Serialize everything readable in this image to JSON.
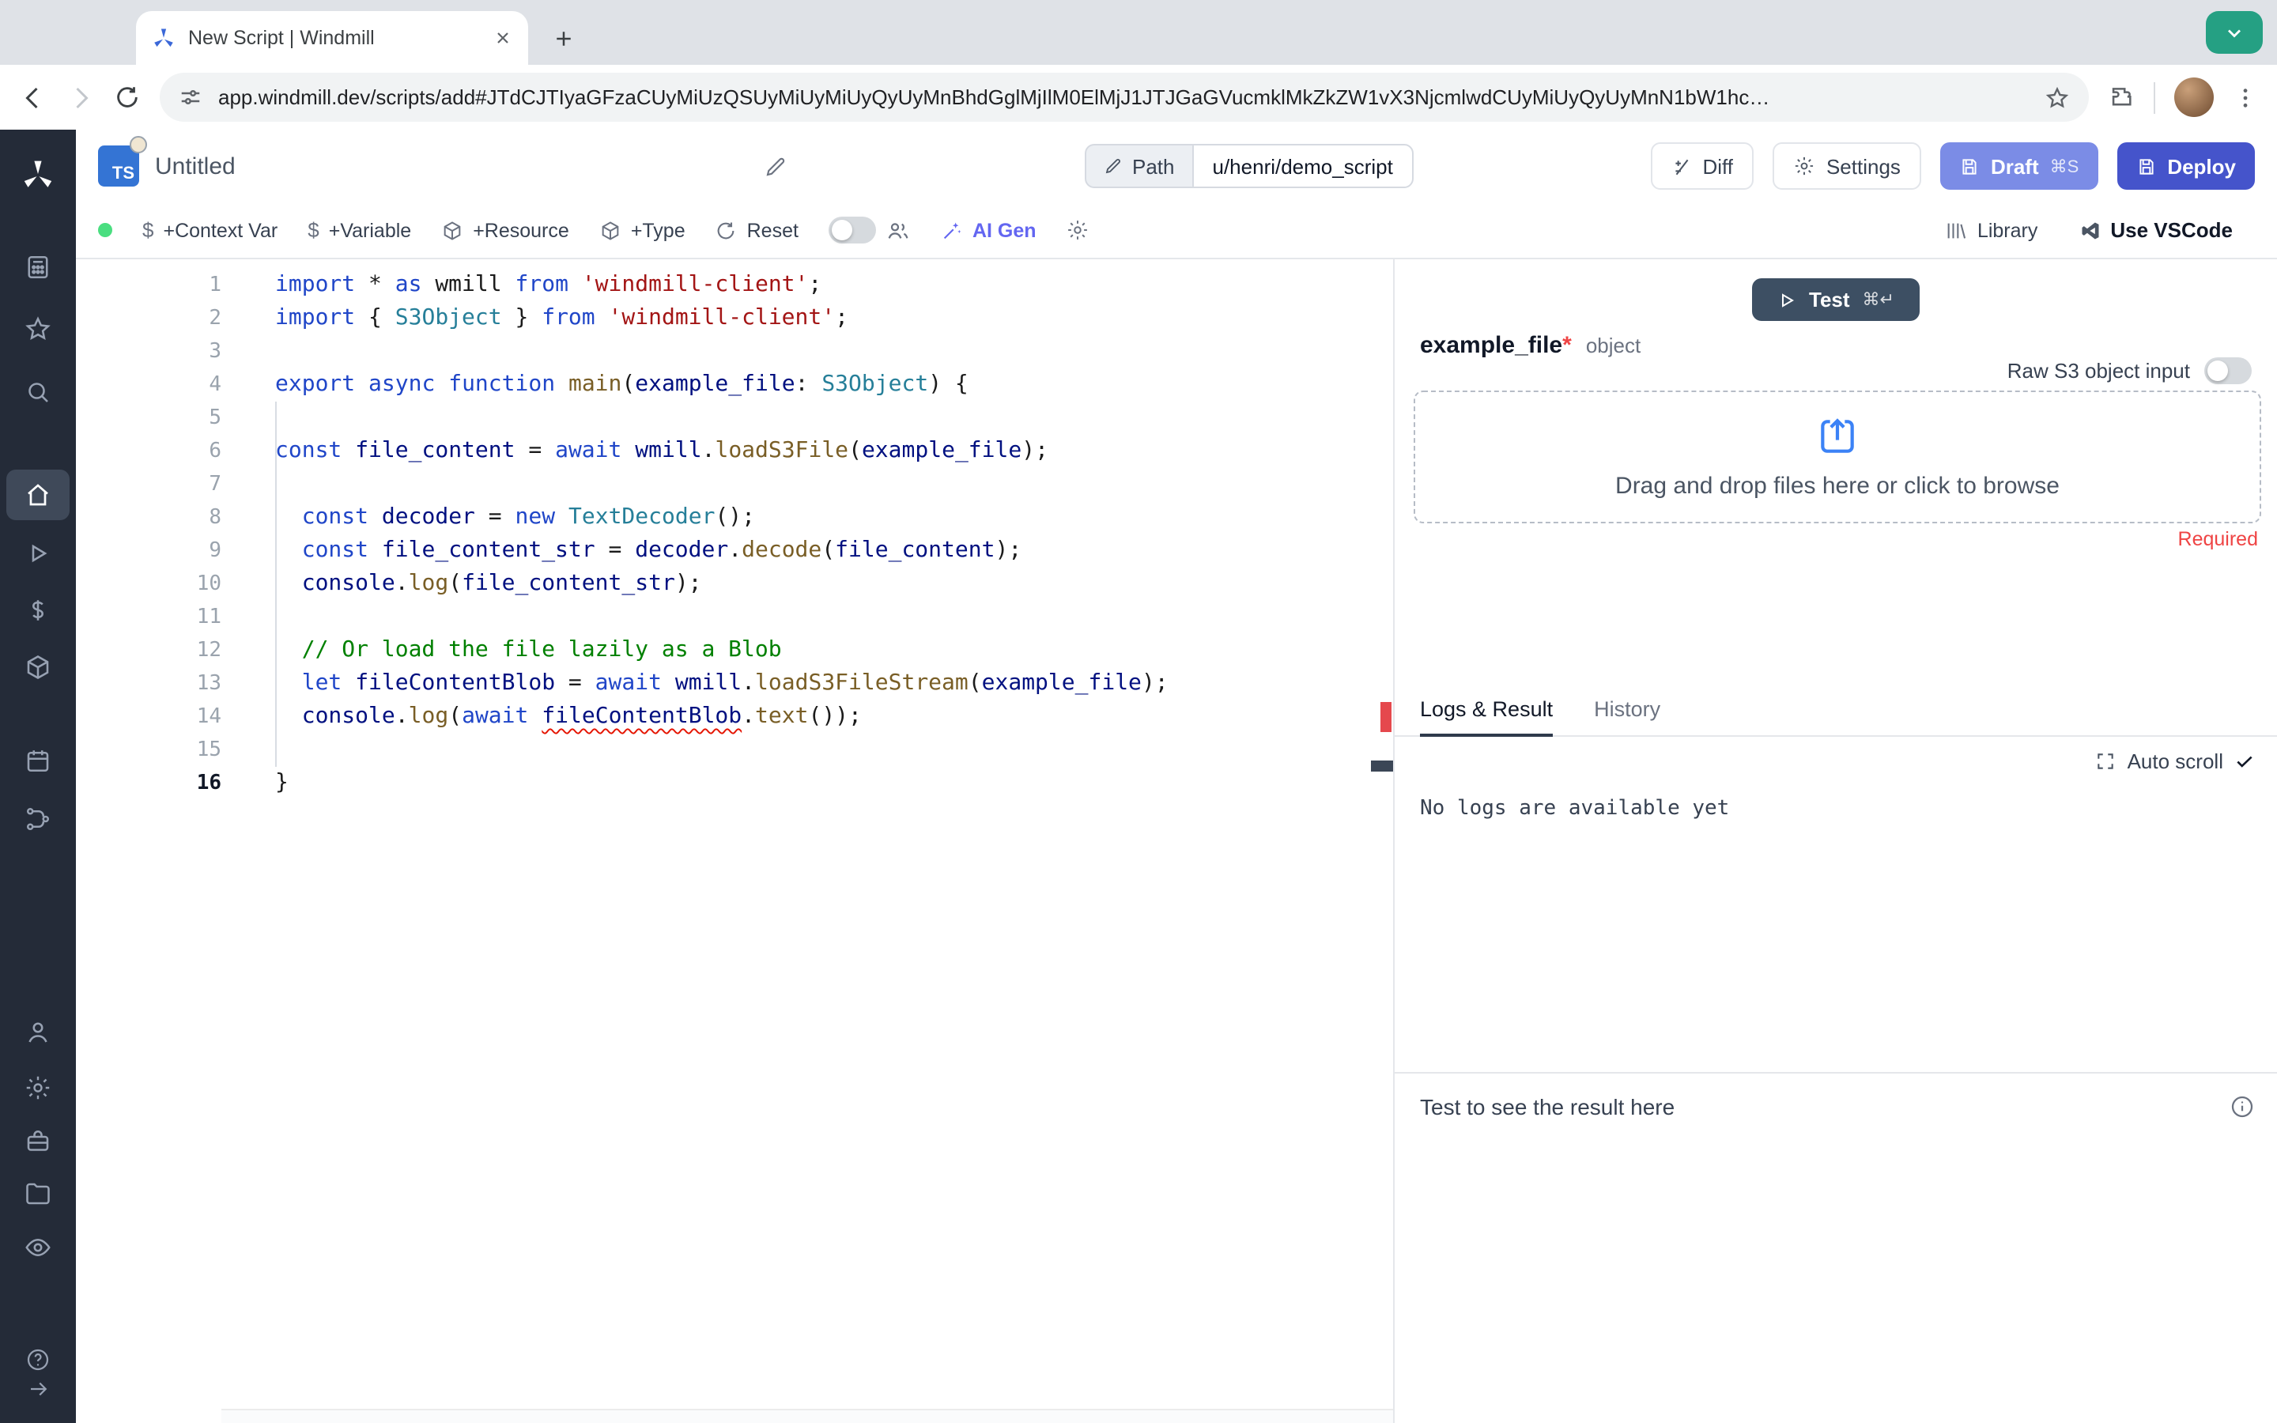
{
  "browser": {
    "tab_title": "New Script | Windmill",
    "url": "app.windmill.dev/scripts/add#JTdCJTIyaGFzaCUyMiUzQSUyMiUyMiUyQyUyMnBhdGglMjIlM0ElMjJ1JTJGaGVucmklMkZkZW1vX3NjcmlwdCUyMiUyQyUyMnN1bW1hc…"
  },
  "header": {
    "ts_badge": "TS",
    "title": "Untitled",
    "path_label": "Path",
    "path_value": "u/henri/demo_script",
    "diff_label": "Diff",
    "settings_label": "Settings",
    "draft_label": "Draft",
    "draft_shortcut": "⌘S",
    "deploy_label": "Deploy"
  },
  "toolbar": {
    "context_var": "+Context Var",
    "variable": "+Variable",
    "resource": "+Resource",
    "type": "+Type",
    "reset": "Reset",
    "ai_gen": "AI Gen",
    "library": "Library",
    "vscode": "Use VSCode"
  },
  "sidebar": {
    "item_names": [
      "windmill-logo",
      "apps",
      "favorites",
      "search",
      "home",
      "runs",
      "variables",
      "resources",
      "schedules",
      "flows",
      "user",
      "settings",
      "workers",
      "folders",
      "audit-logs",
      "help",
      "collapse"
    ]
  },
  "editor": {
    "lines": [
      {
        "n": 1,
        "tokens": [
          [
            "k",
            "import"
          ],
          [
            "p",
            " * "
          ],
          [
            "k",
            "as"
          ],
          [
            "p",
            " wmill "
          ],
          [
            "k",
            "from"
          ],
          [
            "p",
            " "
          ],
          [
            "s",
            "'windmill-client'"
          ],
          [
            "p",
            ";"
          ]
        ]
      },
      {
        "n": 2,
        "tokens": [
          [
            "k",
            "import"
          ],
          [
            "p",
            " { "
          ],
          [
            "t",
            "S3Object"
          ],
          [
            "p",
            " } "
          ],
          [
            "k",
            "from"
          ],
          [
            "p",
            " "
          ],
          [
            "s",
            "'windmill-client'"
          ],
          [
            "p",
            ";"
          ]
        ]
      },
      {
        "n": 3,
        "tokens": []
      },
      {
        "n": 4,
        "tokens": [
          [
            "k",
            "export"
          ],
          [
            "p",
            " "
          ],
          [
            "k",
            "async"
          ],
          [
            "p",
            " "
          ],
          [
            "k",
            "function"
          ],
          [
            "p",
            " "
          ],
          [
            "f",
            "main"
          ],
          [
            "p",
            "("
          ],
          [
            "v",
            "example_file"
          ],
          [
            "p",
            ": "
          ],
          [
            "t",
            "S3Object"
          ],
          [
            "p",
            ") {"
          ]
        ]
      },
      {
        "n": 5,
        "tokens": []
      },
      {
        "n": 6,
        "tokens": [
          [
            "k",
            "const"
          ],
          [
            "p",
            " "
          ],
          [
            "v",
            "file_content"
          ],
          [
            "p",
            " = "
          ],
          [
            "k",
            "await"
          ],
          [
            "p",
            " "
          ],
          [
            "v",
            "wmill"
          ],
          [
            "p",
            "."
          ],
          [
            "f",
            "loadS3File"
          ],
          [
            "p",
            "("
          ],
          [
            "v",
            "example_file"
          ],
          [
            "p",
            ");"
          ]
        ]
      },
      {
        "n": 7,
        "tokens": []
      },
      {
        "n": 8,
        "tokens": [
          [
            "p",
            "  "
          ],
          [
            "k",
            "const"
          ],
          [
            "p",
            " "
          ],
          [
            "v",
            "decoder"
          ],
          [
            "p",
            " = "
          ],
          [
            "k",
            "new"
          ],
          [
            "p",
            " "
          ],
          [
            "t",
            "TextDecoder"
          ],
          [
            "p",
            "();"
          ]
        ]
      },
      {
        "n": 9,
        "tokens": [
          [
            "p",
            "  "
          ],
          [
            "k",
            "const"
          ],
          [
            "p",
            " "
          ],
          [
            "v",
            "file_content_str"
          ],
          [
            "p",
            " = "
          ],
          [
            "v",
            "decoder"
          ],
          [
            "p",
            "."
          ],
          [
            "f",
            "decode"
          ],
          [
            "p",
            "("
          ],
          [
            "v",
            "file_content"
          ],
          [
            "p",
            ");"
          ]
        ]
      },
      {
        "n": 10,
        "tokens": [
          [
            "p",
            "  "
          ],
          [
            "v",
            "console"
          ],
          [
            "p",
            "."
          ],
          [
            "f",
            "log"
          ],
          [
            "p",
            "("
          ],
          [
            "v",
            "file_content_str"
          ],
          [
            "p",
            ");"
          ]
        ]
      },
      {
        "n": 11,
        "tokens": []
      },
      {
        "n": 12,
        "tokens": [
          [
            "p",
            "  "
          ],
          [
            "c",
            "// Or load the file lazily as a Blob"
          ]
        ]
      },
      {
        "n": 13,
        "tokens": [
          [
            "p",
            "  "
          ],
          [
            "k",
            "let"
          ],
          [
            "p",
            " "
          ],
          [
            "v",
            "fileContentBlob"
          ],
          [
            "p",
            " = "
          ],
          [
            "k",
            "await"
          ],
          [
            "p",
            " "
          ],
          [
            "v",
            "wmill"
          ],
          [
            "p",
            "."
          ],
          [
            "f",
            "loadS3FileStream"
          ],
          [
            "p",
            "("
          ],
          [
            "v",
            "example_file"
          ],
          [
            "p",
            ");"
          ]
        ]
      },
      {
        "n": 14,
        "tokens": [
          [
            "p",
            "  "
          ],
          [
            "v",
            "console"
          ],
          [
            "p",
            "."
          ],
          [
            "f",
            "log"
          ],
          [
            "p",
            "("
          ],
          [
            "k",
            "await"
          ],
          [
            "p",
            " "
          ],
          [
            "vq",
            "fileContentBlob"
          ],
          [
            "p",
            "."
          ],
          [
            "f",
            "text"
          ],
          [
            "p",
            "());"
          ]
        ]
      },
      {
        "n": 15,
        "tokens": []
      },
      {
        "n": 16,
        "active": true,
        "tokens": [
          [
            "p",
            "}"
          ]
        ]
      }
    ]
  },
  "panel": {
    "test_label": "Test",
    "test_shortcut": "⌘↵",
    "arg_name": "example_file",
    "required_star": "*",
    "arg_type": "object",
    "raw_s3_label": "Raw S3 object input",
    "dropzone_text": "Drag and drop files here or click to browse",
    "required_label": "Required",
    "tabs": {
      "logs": "Logs & Result",
      "history": "History"
    },
    "auto_scroll_label": "Auto scroll",
    "no_logs_text": "No logs are available yet",
    "result_placeholder": "Test to see the result here"
  },
  "colors": {
    "accent_blue": "#3b82f6",
    "draft_button": "#7b8ce6",
    "deploy_button": "#4554cb",
    "test_button": "#3d4f63",
    "required_red": "#ef4444",
    "status_green": "#4ade80",
    "ai_gen_indigo": "#6366f1",
    "chrome_chip_teal": "#25a083",
    "sidebar_bg": "#242b38"
  }
}
